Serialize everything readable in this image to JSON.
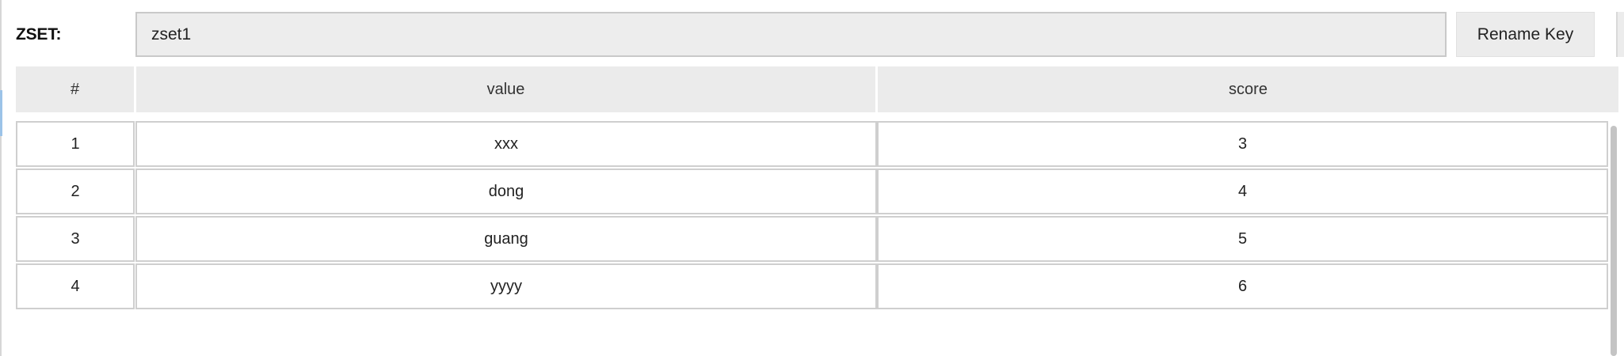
{
  "key_editor": {
    "type_label": "ZSET:",
    "key_value": "zset1",
    "rename_label": "Rename Key"
  },
  "table": {
    "headers": [
      "#",
      "value",
      "score"
    ],
    "rows": [
      {
        "index": "1",
        "value": "xxx",
        "score": "3"
      },
      {
        "index": "2",
        "value": "dong",
        "score": "4"
      },
      {
        "index": "3",
        "value": "guang",
        "score": "5"
      },
      {
        "index": "4",
        "value": "yyyy",
        "score": "6"
      }
    ]
  }
}
